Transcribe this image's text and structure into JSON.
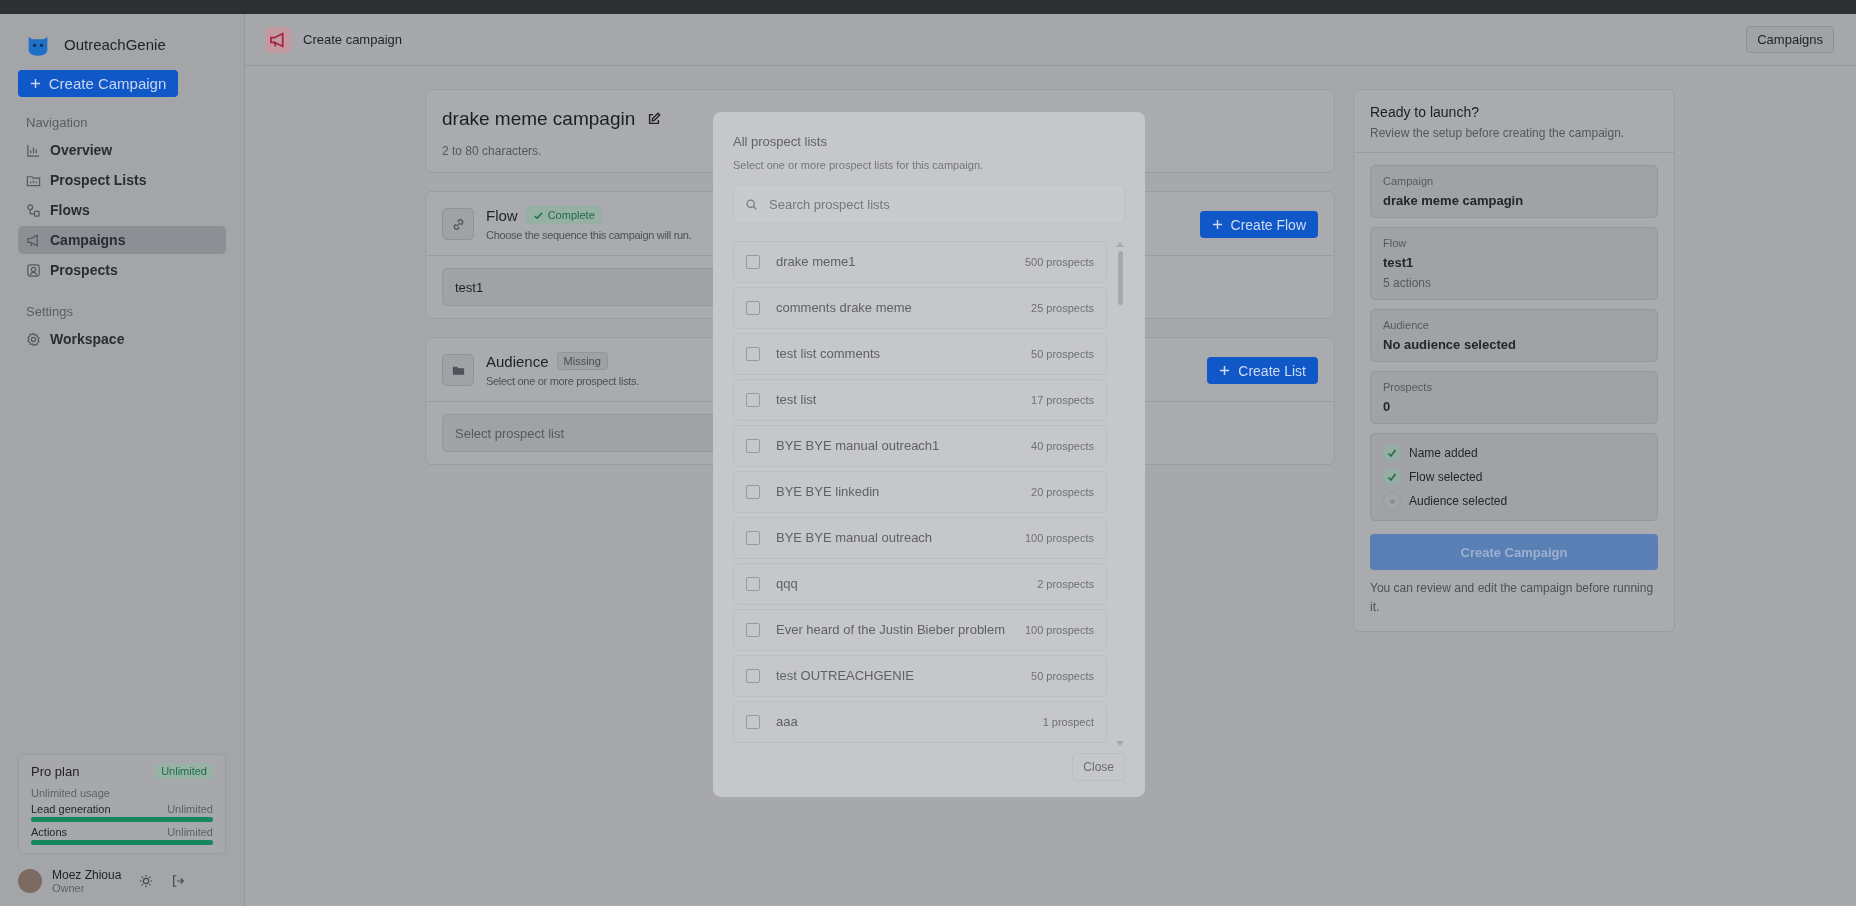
{
  "app": {
    "name": "OutreachGenie",
    "create_button": "Create Campaign"
  },
  "sidebar": {
    "sections": [
      {
        "title": "Navigation",
        "items": [
          {
            "label": "Overview",
            "selected": false
          },
          {
            "label": "Prospect Lists",
            "selected": false
          },
          {
            "label": "Flows",
            "selected": false
          },
          {
            "label": "Campaigns",
            "selected": true
          },
          {
            "label": "Prospects",
            "selected": false
          }
        ]
      },
      {
        "title": "Settings",
        "items": [
          {
            "label": "Workspace",
            "selected": false
          }
        ]
      }
    ]
  },
  "plan": {
    "name": "Pro plan",
    "badge": "Unlimited",
    "usage": "Unlimited usage",
    "meters": [
      {
        "label": "Lead generation",
        "value": "Unlimited",
        "level": 1
      },
      {
        "label": "Actions",
        "value": "Unlimited",
        "level": 1
      }
    ]
  },
  "user": {
    "name": "Moez Zhioua",
    "role": "Owner"
  },
  "header": {
    "title": "Create campaign",
    "button": "Campaigns"
  },
  "campaign_name": {
    "value": "drake meme campagin",
    "hint": "2 to 80 characters."
  },
  "sections": [
    {
      "kind": "flow",
      "title": "Flow",
      "status": "Complete",
      "complete": true,
      "description": "Choose the sequence this campaign will run.",
      "button": "Create Flow",
      "select": {
        "value": "test1"
      }
    },
    {
      "kind": "audience",
      "title": "Audience",
      "status": "Missing",
      "complete": false,
      "description": "Select one or more prospect lists.",
      "button": "Create List",
      "select": {
        "placeholder": "Select prospect list"
      }
    }
  ],
  "summary": {
    "title": "Ready to launch?",
    "subtitle": "Review the setup before creating the campaign.",
    "fields": [
      {
        "label": "Campaign",
        "value": "drake meme campagin"
      },
      {
        "label": "Flow",
        "value": "test1",
        "detail": "5 actions"
      },
      {
        "label": "Audience",
        "value": "No audience selected"
      },
      {
        "label": "Prospects",
        "value": "0"
      }
    ],
    "checklist": [
      {
        "label": "Name added",
        "done": true
      },
      {
        "label": "Flow selected",
        "done": true
      },
      {
        "label": "Audience selected",
        "done": false
      }
    ],
    "button": {
      "label": "Create Campaign",
      "disabled": true
    },
    "note": "You can review and edit the campaign before running it."
  },
  "modal": {
    "title": "All prospect lists",
    "subtitle": "Select one or more prospect lists for this campaign.",
    "search": {
      "placeholder": "Search prospect lists"
    },
    "lists": [
      {
        "name": "drake meme1",
        "count": "500 prospects",
        "checked": false
      },
      {
        "name": "comments drake meme",
        "count": "25 prospects",
        "checked": false
      },
      {
        "name": "test list comments",
        "count": "50 prospects",
        "checked": false
      },
      {
        "name": "test list",
        "count": "17 prospects",
        "checked": false
      },
      {
        "name": "BYE BYE manual outreach1",
        "count": "40 prospects",
        "checked": false
      },
      {
        "name": "BYE BYE linkedin",
        "count": "20 prospects",
        "checked": false
      },
      {
        "name": "BYE BYE manual outreach",
        "count": "100 prospects",
        "checked": false
      },
      {
        "name": "qqq",
        "count": "2 prospects",
        "checked": false
      },
      {
        "name": "Ever heard of the Justin Bieber problem",
        "count": "100 prospects",
        "checked": false
      },
      {
        "name": "test OUTREACHGENIE",
        "count": "50 prospects",
        "checked": false
      },
      {
        "name": "aaa",
        "count": "1 prospect",
        "checked": false
      }
    ],
    "close": "Close"
  }
}
